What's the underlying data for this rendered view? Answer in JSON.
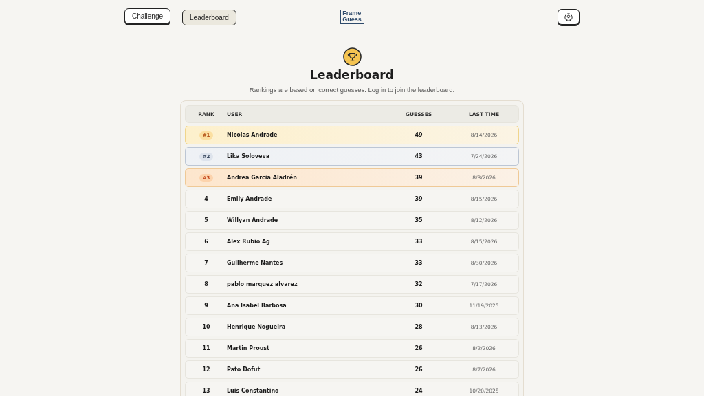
{
  "nav": [
    {
      "label": "Challenge",
      "selected": false
    },
    {
      "label": "Leaderboard",
      "selected": true
    }
  ],
  "logo": {
    "line_1": "Frame",
    "line_2": "Guess"
  },
  "title": "Leaderboard",
  "subtitle": "Rankings are based on correct guesses. Log in to join the leaderboard.",
  "table": {
    "columns": [
      "RANK",
      "USER",
      "GUESSES",
      "LAST TIME"
    ],
    "rows": [
      {
        "kind": "gold",
        "rank": "#1",
        "user": "Nicolas Andrade",
        "guesses": "49",
        "last_time": "8/14/2026"
      },
      {
        "kind": "silver",
        "rank": "#2",
        "user": "Lika Soloveva",
        "guesses": "43",
        "last_time": "7/24/2026"
      },
      {
        "kind": "bronze",
        "rank": "#3",
        "user": "Andrea García Aladrén",
        "guesses": "39",
        "last_time": "8/3/2026"
      },
      {
        "kind": "plain",
        "rank": "4",
        "user": "Emily Andrade",
        "guesses": "39",
        "last_time": "8/15/2026"
      },
      {
        "kind": "plain",
        "rank": "5",
        "user": "Willyan Andrade",
        "guesses": "35",
        "last_time": "8/12/2026"
      },
      {
        "kind": "plain",
        "rank": "6",
        "user": "Alex Rubio Ag",
        "guesses": "33",
        "last_time": "8/15/2026"
      },
      {
        "kind": "plain",
        "rank": "7",
        "user": "Guilherme Nantes",
        "guesses": "33",
        "last_time": "8/30/2026"
      },
      {
        "kind": "plain",
        "rank": "8",
        "user": "pablo marquez alvarez",
        "guesses": "32",
        "last_time": "7/17/2026"
      },
      {
        "kind": "plain",
        "rank": "9",
        "user": "Ana Isabel Barbosa",
        "guesses": "30",
        "last_time": "11/19/2025"
      },
      {
        "kind": "plain",
        "rank": "10",
        "user": "Henrique Nogueira",
        "guesses": "28",
        "last_time": "8/13/2026"
      },
      {
        "kind": "plain",
        "rank": "11",
        "user": "Martin Proust",
        "guesses": "26",
        "last_time": "8/2/2026"
      },
      {
        "kind": "plain",
        "rank": "12",
        "user": "Pato Dofut",
        "guesses": "26",
        "last_time": "8/7/2026"
      },
      {
        "kind": "plain",
        "rank": "13",
        "user": "Luís Constantino",
        "guesses": "24",
        "last_time": "10/20/2025"
      }
    ]
  }
}
